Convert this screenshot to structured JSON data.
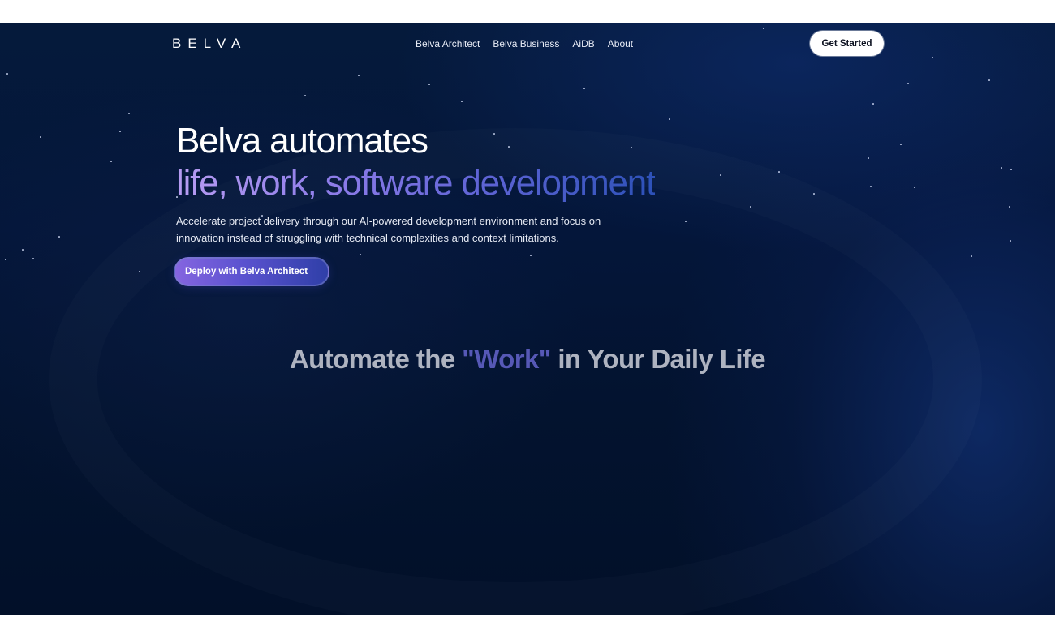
{
  "brand": {
    "logo_text": "BELVA"
  },
  "nav": {
    "links": [
      {
        "label": "Belva Architect"
      },
      {
        "label": "Belva Business"
      },
      {
        "label": "AiDB"
      },
      {
        "label": "About"
      }
    ],
    "cta_label": "Get Started"
  },
  "hero": {
    "title_line1": "Belva automates",
    "title_line2": "life, work, software development",
    "description": "Accelerate project delivery through our AI-powered development environment and focus on innovation instead of struggling with technical complexities and context limitations.",
    "button_label": "Deploy with Belva Architect"
  },
  "section": {
    "title_before": "Automate the ",
    "title_accent": "\"Work\"",
    "title_after": " in Your Daily Life"
  },
  "colors": {
    "background": "#04163a",
    "accent_purple": "#8a7ae8",
    "accent_blue": "#2d51b8",
    "cta_bg": "#ffffff"
  }
}
